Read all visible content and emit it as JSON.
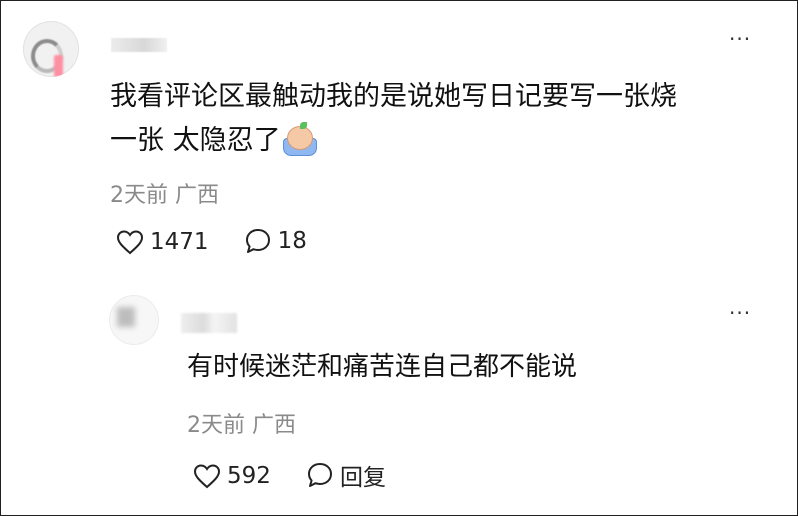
{
  "comment": {
    "text_line1": "我看评论区最触动我的是说她写日记要写一张烧",
    "text_line2": "一张 太隐忍了",
    "emoji": "crying-emoji",
    "time": "2天前",
    "location": "广西",
    "likes": "1471",
    "replies": "18",
    "more": "···"
  },
  "reply": {
    "text": "有时候迷茫和痛苦连自己都不能说",
    "time": "2天前",
    "location": "广西",
    "likes": "592",
    "reply_label": "回复",
    "more": "···"
  },
  "icons": {
    "heart": "heart-icon",
    "comment": "comment-bubble-icon",
    "more": "more-icon"
  }
}
